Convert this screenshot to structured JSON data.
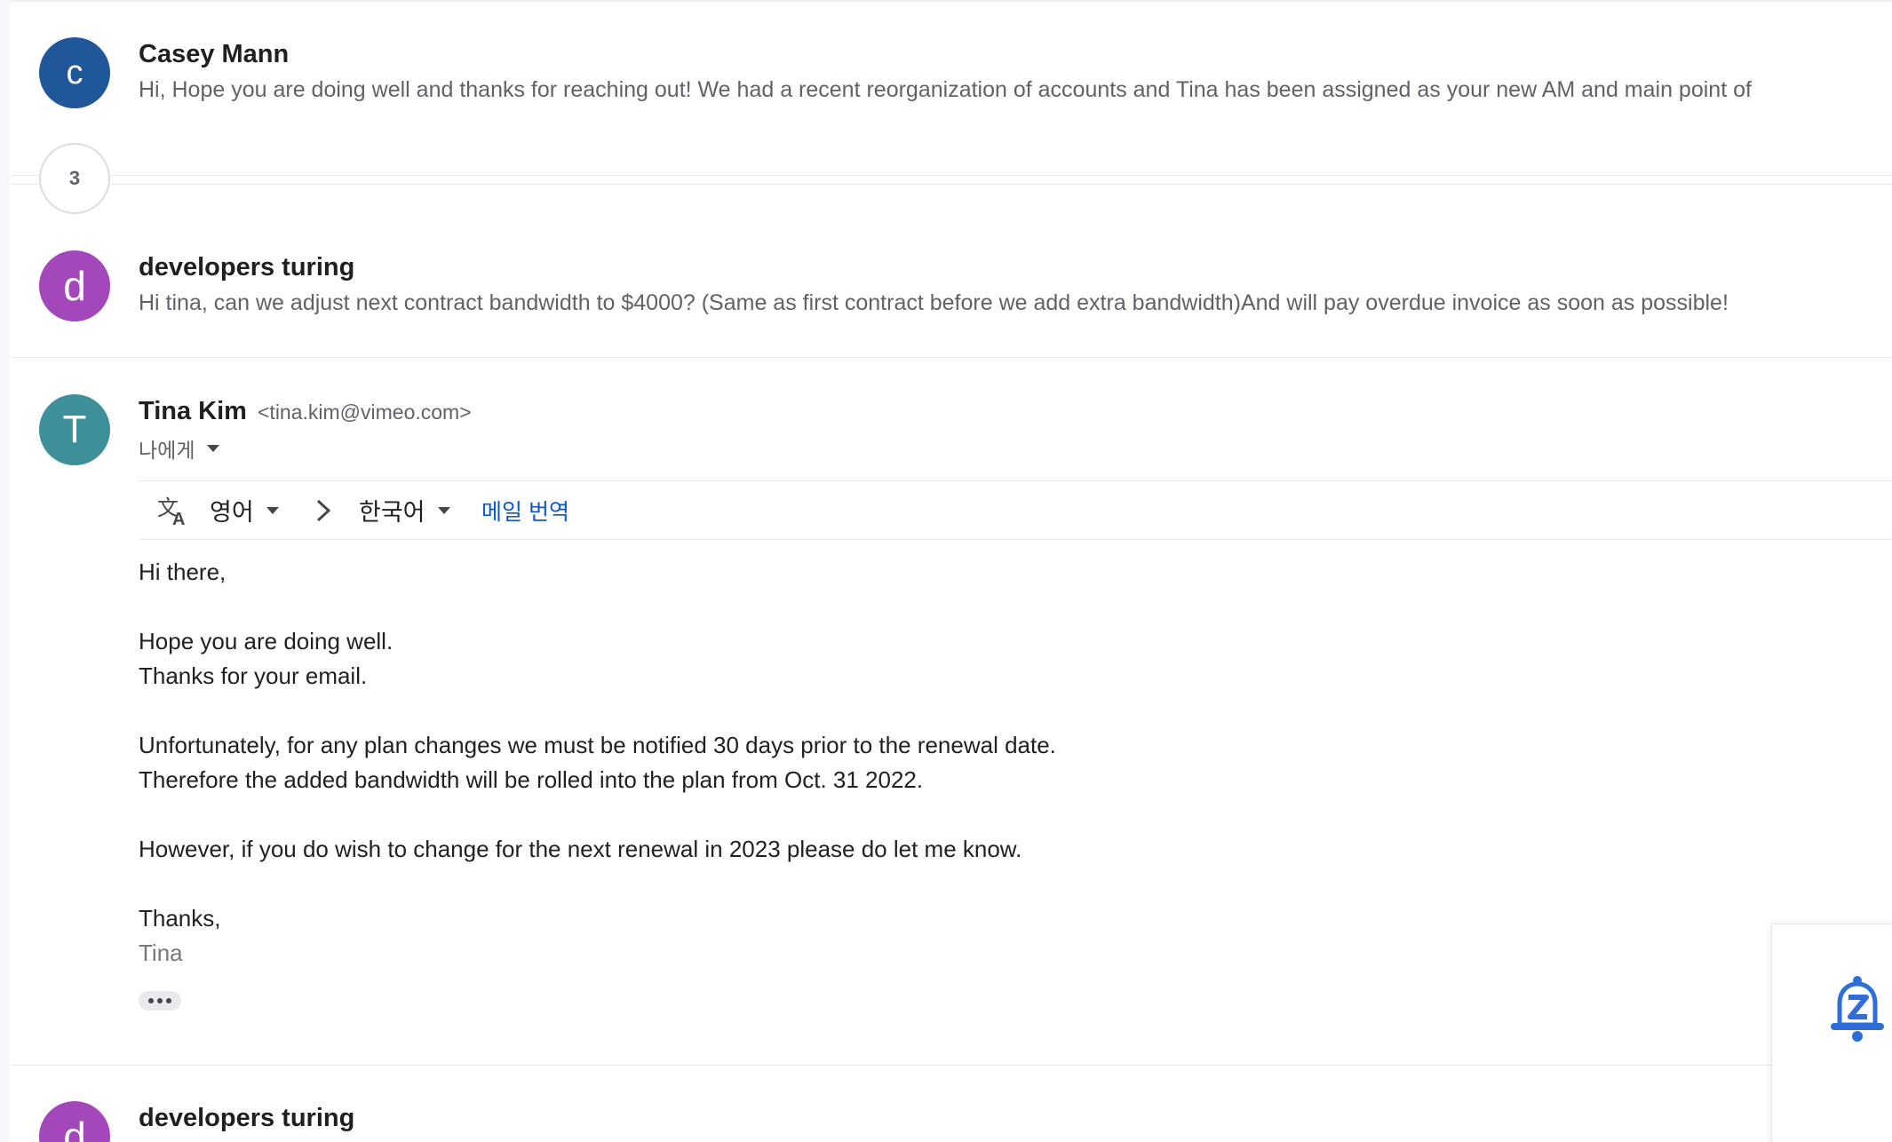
{
  "threads": {
    "first": {
      "avatar_letter": "c",
      "sender": "Casey Mann",
      "snippet": "Hi, Hope you are doing well and thanks for reaching out! We had a recent reorganization of accounts and Tina has been assigned as your new AM and main point of"
    },
    "collapsed_count": "3",
    "second": {
      "avatar_letter": "d",
      "sender": "developers turing",
      "snippet": "Hi tina, can we adjust next contract bandwidth to $4000? (Same as first contract before we add extra bandwidth)And will pay overdue invoice as soon as possible!"
    },
    "open": {
      "avatar_letter": "T",
      "sender": "Tina Kim",
      "email": "<tina.kim@vimeo.com>",
      "recipient_label": "나에게"
    },
    "last": {
      "avatar_letter": "d",
      "sender": "developers turing"
    }
  },
  "translate": {
    "source_lang": "영어",
    "target_lang": "한국어",
    "action_label": "메일 번역"
  },
  "message": {
    "greeting": "Hi there,",
    "line1": "Hope you are doing well.",
    "line2": "Thanks for your email.",
    "line3": "Unfortunately, for any plan changes we must be notified 30 days prior to the renewal date.",
    "line4": "Therefore the added bandwidth will be rolled into the plan from Oct. 31 2022.",
    "line5": "However, if you do wish to change for the next renewal in 2023 please do let me know.",
    "closing": "Thanks,",
    "signature": "Tina"
  },
  "colors": {
    "avatar_c": "#1f5799",
    "avatar_d": "#a347ba",
    "avatar_t": "#3d8f9a",
    "link": "#0b57d0",
    "bell": "#2f6ed8"
  }
}
